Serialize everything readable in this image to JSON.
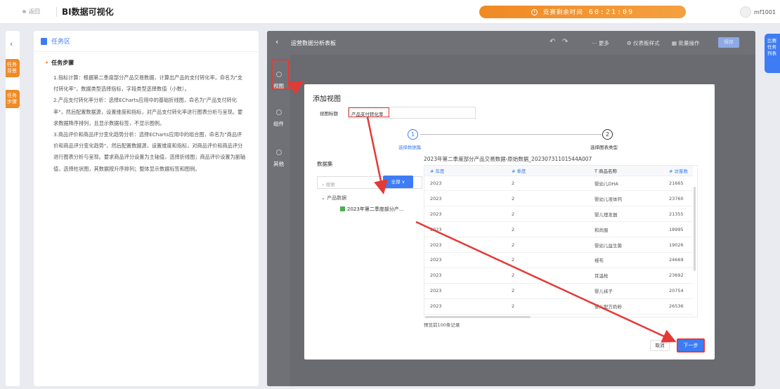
{
  "topbar": {
    "back_label": "返回",
    "app_title": "BI数据可视化",
    "timer_label": "竞赛剩余时间",
    "timer_value": "60:21:09",
    "username": "mf1001"
  },
  "left_tabs": [
    "任务背景",
    "任务步骤"
  ],
  "task_panel": {
    "header": "任务区",
    "steps_title": "任务步骤",
    "steps_text": "1.指标计算：根据第二季度部分产品交易数据，计算出产品的支付转化率，命名为\"支付转化率\"，数据类型选择指标，字段类型选择数值（小数）。\n2.产品支付转化率分析：选择ECharts应用中的基础折线图，命名为\"产品支付转化率\"，然后配置数据源，设置维度和指标，对产品支付转化率进行图表分析与呈现。要求数据降序排列，且显示数据标签，不显示图例。\n3.商品评价和商品评分变化趋势分析：选择ECharts应用中的组合图，命名为\"商品评价和商品评分变化趋势\"，然后配置数据源，设置维度和指标，对商品评价和商品评分进行图表分析与呈现。要求商品评分设置为主轴值，选择折线图；商品评价设置为副轴值，选择柱状图，其数据按升序排列；整体显示数据标签和图例。"
  },
  "editor": {
    "title": "运营数据分析表板",
    "tools": [
      "更多",
      "仪表板样式",
      "批量操作"
    ],
    "save_label": "保存",
    "side_items": [
      "视图",
      "组件",
      "其他"
    ]
  },
  "dialog": {
    "title": "添加视图",
    "view_title_label": "视图标题",
    "view_title_value": "产品支付转化率",
    "steps": [
      {
        "num": "1",
        "label": "选择数据集"
      },
      {
        "num": "2",
        "label": "选择图表类型"
      }
    ],
    "dataset_label": "数据集",
    "search_placeholder": "搜索",
    "all_button": "全部 ∨",
    "tree_parent": "产品数据",
    "tree_child": "2023年第二季度部分产...",
    "preview_title": "2023年第二季度部分产品交易数据-原始数据_20230731101544A007",
    "columns": [
      "# 年度",
      "# 季度",
      "T 商品名称",
      "# 访客数"
    ],
    "rows": [
      [
        "2023",
        "2",
        "婴幼儿DHA",
        "21665"
      ],
      [
        "2023",
        "2",
        "婴幼儿液体钙",
        "23760"
      ],
      [
        "2023",
        "2",
        "婴儿理发器",
        "21355"
      ],
      [
        "2023",
        "2",
        "和尚服",
        "18995"
      ],
      [
        "2023",
        "2",
        "婴幼儿益生菌",
        "19026"
      ],
      [
        "2023",
        "2",
        "襁布",
        "24669"
      ],
      [
        "2023",
        "2",
        "耳温枪",
        "23692"
      ],
      [
        "2023",
        "2",
        "婴儿袜子",
        "20754"
      ],
      [
        "2023",
        "2",
        "婴儿配方奶粉",
        "26536"
      ]
    ],
    "preview_note": "预览前100条记录",
    "cancel_label": "取消",
    "next_label": "下一步"
  },
  "right_tab": "比赛任务列表",
  "colors": {
    "accent": "#3d7cf5",
    "timer": "#f08a24",
    "highlight": "#e53935"
  }
}
